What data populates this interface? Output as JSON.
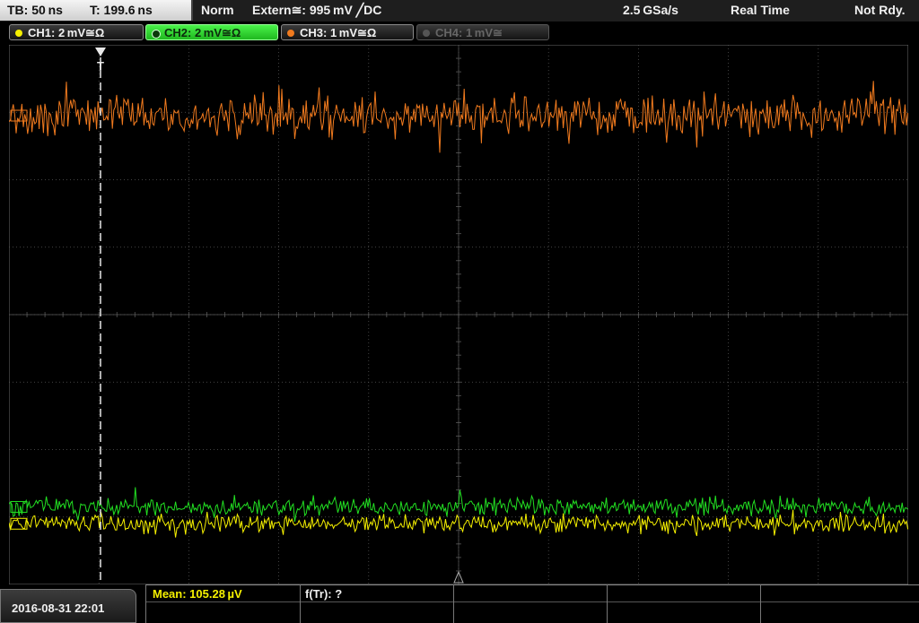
{
  "status": {
    "timebase": "TB: 50 ns",
    "trigger_time": "T: 199.6 ns",
    "trigger_mode": "Norm",
    "trigger_source": "Extern≅: 995 mV ╱DC",
    "sample_rate": "2.5 GSa/s",
    "acq_mode": "Real Time",
    "ready_state": "Not Rdy."
  },
  "channels": [
    {
      "label": "CH1: 2 mV≅Ω",
      "color": "#f5f000",
      "state": "on"
    },
    {
      "label": "CH2: 2 mV≅Ω",
      "color": "#22e022",
      "state": "active"
    },
    {
      "label": "CH3: 1 mV≅Ω",
      "color": "#f07a1e",
      "state": "on"
    },
    {
      "label": "CH4: 1 mV≅",
      "color": "#555555",
      "state": "off"
    }
  ],
  "screen": {
    "trigger_marker": "T",
    "grid_color": "#5a5a5a"
  },
  "waveforms": [
    {
      "channel": "CH3",
      "color": "#f07a1e",
      "level_div": 1.05,
      "noise_div": 0.25
    },
    {
      "channel": "CH2",
      "color": "#22e022",
      "level_div": 6.85,
      "noise_div": 0.12
    },
    {
      "channel": "CH1",
      "color": "#f5f000",
      "level_div": 7.1,
      "noise_div": 0.12
    }
  ],
  "footer": {
    "datetime": "2016-08-31 22:01",
    "measurement_1": "Mean: 105.28 µV",
    "measurement_1_color": "#f5f000",
    "measurement_2": "f(Tr): ?"
  }
}
